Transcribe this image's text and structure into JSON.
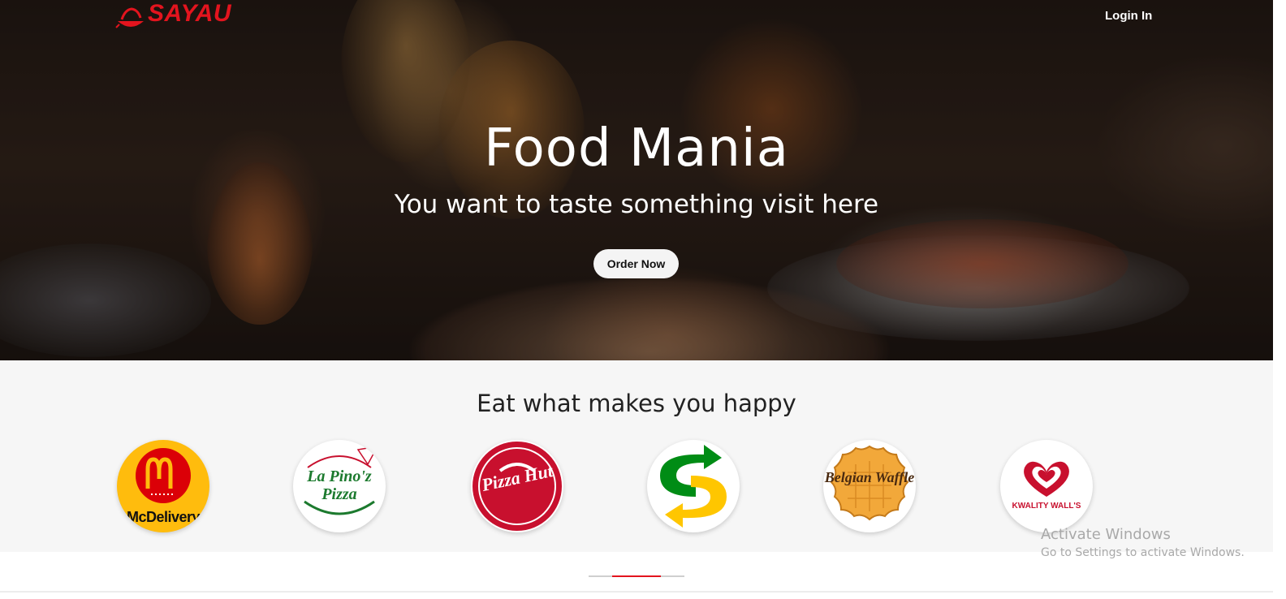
{
  "header": {
    "logo_text": "SAYAU",
    "login_label": "Login In"
  },
  "hero": {
    "title": "Food Mania",
    "subtitle": "You want to taste something visit here",
    "cta_label": "Order Now"
  },
  "brands": {
    "title": "Eat what makes you happy",
    "items": [
      {
        "name": "McDelivery",
        "label": "McDelivery",
        "color": "#ffbc0d"
      },
      {
        "name": "La Pino'z Pizza",
        "label": "La Pino'z Pizza",
        "color": "#1c7a2e"
      },
      {
        "name": "Pizza Hut",
        "label": "Pizza Hut",
        "color": "#c8102e"
      },
      {
        "name": "Subway",
        "label": "",
        "color": "#008c15"
      },
      {
        "name": "Belgian Waffle",
        "label": "Belgian Waffle",
        "color": "#f2a83a"
      },
      {
        "name": "Kwality Wall's",
        "label": "KWALITY WALL'S",
        "color": "#c8102e"
      }
    ]
  },
  "watermark": {
    "line1": "Activate Windows",
    "line2": "Go to Settings to activate Windows."
  },
  "colors": {
    "accent": "#e3141e",
    "section_bg": "#f6f6f6"
  }
}
